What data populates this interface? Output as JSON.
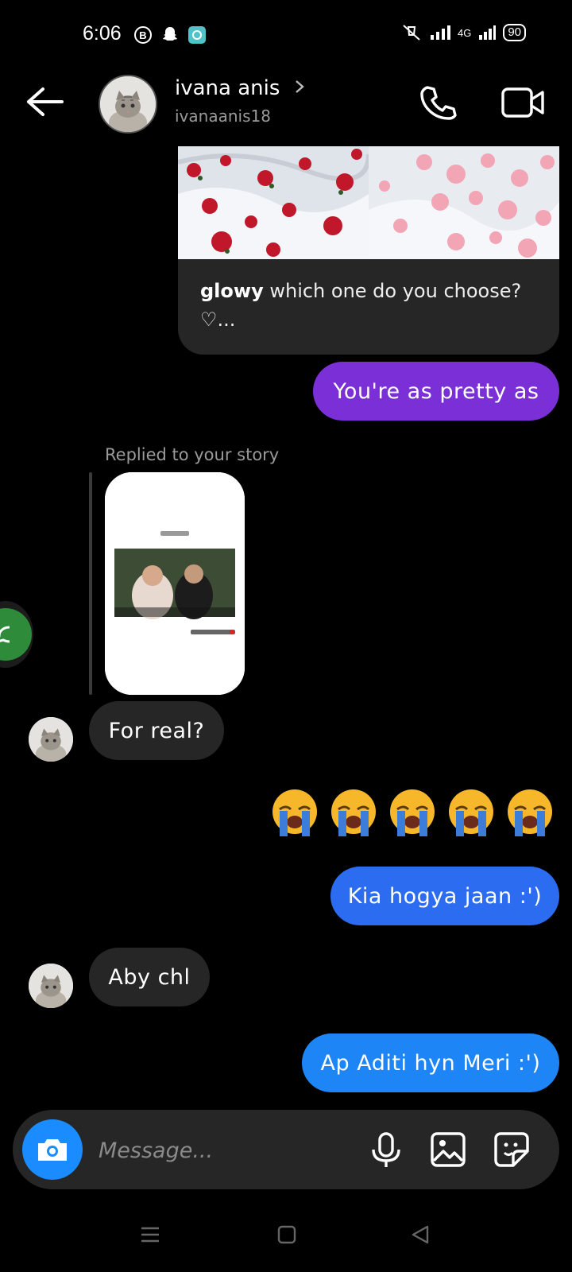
{
  "status_bar": {
    "time": "6:06",
    "network": "4G",
    "battery": "90"
  },
  "header": {
    "name": "ivana anis",
    "username": "ivanaanis18"
  },
  "shared_post": {
    "caption_user": "glowy",
    "caption_text": " which one do you choose?",
    "caption_more": "♡..."
  },
  "messages": [
    {
      "id": "sent-1",
      "text": "You're as pretty as",
      "sender": "me",
      "color": "#7b2fd6"
    },
    {
      "id": "story-reply",
      "label": "Replied to your story"
    },
    {
      "id": "recv-1",
      "text": "For real?",
      "sender": "them"
    },
    {
      "id": "emoji-1",
      "emoji": [
        "😭",
        "😭",
        "😭",
        "😭",
        "😭"
      ],
      "sender": "me"
    },
    {
      "id": "sent-2",
      "text": "Kia hogya jaan :')",
      "sender": "me",
      "color": "#2c6cf0"
    },
    {
      "id": "recv-2",
      "text": "Aby chl",
      "sender": "them"
    },
    {
      "id": "sent-3",
      "text": "Ap Aditi hyn Meri :')",
      "sender": "me",
      "color": "#1d85f5"
    }
  ],
  "composer": {
    "placeholder": "Message..."
  },
  "colors": {
    "received_bubble": "#262626",
    "camera_button": "#1a8cff"
  }
}
